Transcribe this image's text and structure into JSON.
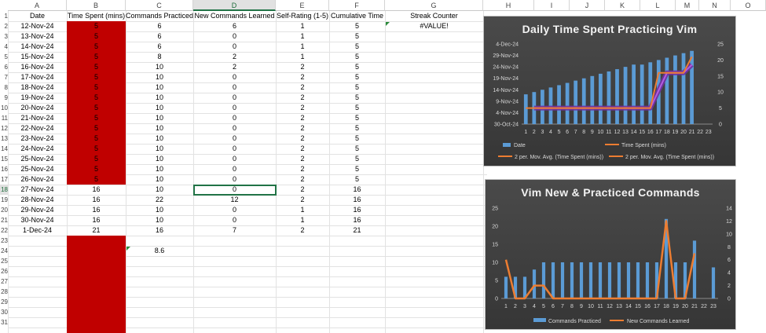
{
  "columns": [
    "A",
    "B",
    "C",
    "D",
    "E",
    "F",
    "G",
    "H",
    "I",
    "J",
    "K",
    "L",
    "M",
    "N",
    "O"
  ],
  "selected_column": "D",
  "selected_row": "18",
  "row_numbers": [
    "1",
    "2",
    "3",
    "4",
    "5",
    "6",
    "7",
    "8",
    "9",
    "10",
    "11",
    "12",
    "13",
    "14",
    "15",
    "16",
    "17",
    "18",
    "19",
    "20",
    "21",
    "22",
    "23",
    "24",
    "25",
    "26",
    "27",
    "28",
    "29",
    "30",
    "31"
  ],
  "headers": {
    "date": "Date",
    "time": "Time Spent (mins)",
    "practiced": "Commands Practiced",
    "learned": "New Commands Learned",
    "rating": "Self-Rating (1-5)",
    "cumulative": "Cumulative Time",
    "streak": "Streak Counter"
  },
  "streak_value": "#VALUE!",
  "rows": [
    {
      "date": "12-Nov-24",
      "time": "5",
      "practiced": "6",
      "learned": "6",
      "rating": "1",
      "cumulative": "5"
    },
    {
      "date": "13-Nov-24",
      "time": "5",
      "practiced": "6",
      "learned": "0",
      "rating": "1",
      "cumulative": "5"
    },
    {
      "date": "14-Nov-24",
      "time": "5",
      "practiced": "6",
      "learned": "0",
      "rating": "1",
      "cumulative": "5"
    },
    {
      "date": "15-Nov-24",
      "time": "5",
      "practiced": "8",
      "learned": "2",
      "rating": "1",
      "cumulative": "5"
    },
    {
      "date": "16-Nov-24",
      "time": "5",
      "practiced": "10",
      "learned": "2",
      "rating": "2",
      "cumulative": "5"
    },
    {
      "date": "17-Nov-24",
      "time": "5",
      "practiced": "10",
      "learned": "0",
      "rating": "2",
      "cumulative": "5"
    },
    {
      "date": "18-Nov-24",
      "time": "5",
      "practiced": "10",
      "learned": "0",
      "rating": "2",
      "cumulative": "5"
    },
    {
      "date": "19-Nov-24",
      "time": "5",
      "practiced": "10",
      "learned": "0",
      "rating": "2",
      "cumulative": "5"
    },
    {
      "date": "20-Nov-24",
      "time": "5",
      "practiced": "10",
      "learned": "0",
      "rating": "2",
      "cumulative": "5"
    },
    {
      "date": "21-Nov-24",
      "time": "5",
      "practiced": "10",
      "learned": "0",
      "rating": "2",
      "cumulative": "5"
    },
    {
      "date": "22-Nov-24",
      "time": "5",
      "practiced": "10",
      "learned": "0",
      "rating": "2",
      "cumulative": "5"
    },
    {
      "date": "23-Nov-24",
      "time": "5",
      "practiced": "10",
      "learned": "0",
      "rating": "2",
      "cumulative": "5"
    },
    {
      "date": "24-Nov-24",
      "time": "5",
      "practiced": "10",
      "learned": "0",
      "rating": "2",
      "cumulative": "5"
    },
    {
      "date": "25-Nov-24",
      "time": "5",
      "practiced": "10",
      "learned": "0",
      "rating": "2",
      "cumulative": "5"
    },
    {
      "date": "25-Nov-24",
      "time": "5",
      "practiced": "10",
      "learned": "0",
      "rating": "2",
      "cumulative": "5"
    },
    {
      "date": "26-Nov-24",
      "time": "5",
      "practiced": "10",
      "learned": "0",
      "rating": "2",
      "cumulative": "5"
    },
    {
      "date": "27-Nov-24",
      "time": "16",
      "practiced": "10",
      "learned": "0",
      "rating": "2",
      "cumulative": "16"
    },
    {
      "date": "28-Nov-24",
      "time": "16",
      "practiced": "22",
      "learned": "12",
      "rating": "2",
      "cumulative": "16"
    },
    {
      "date": "29-Nov-24",
      "time": "16",
      "practiced": "10",
      "learned": "0",
      "rating": "1",
      "cumulative": "16"
    },
    {
      "date": "30-Nov-24",
      "time": "16",
      "practiced": "10",
      "learned": "0",
      "rating": "1",
      "cumulative": "16"
    },
    {
      "date": "1-Dec-24",
      "time": "21",
      "practiced": "16",
      "learned": "7",
      "rating": "2",
      "cumulative": "21"
    }
  ],
  "average_value": "8.6",
  "colors": {
    "red_fill": "#c00000",
    "chart_bg": "#404040",
    "bar_blue": "#5b9bd5",
    "line_orange": "#ed7d31",
    "mavg_purple": "#7030a0",
    "selection_green": "#217346"
  },
  "chart_data": [
    {
      "type": "bar",
      "title": "Daily Time Spent Practicing Vim",
      "categories": [
        "1",
        "2",
        "3",
        "4",
        "5",
        "6",
        "7",
        "8",
        "9",
        "10",
        "11",
        "12",
        "13",
        "14",
        "15",
        "16",
        "17",
        "18",
        "19",
        "20",
        "21",
        "22",
        "23"
      ],
      "left_axis_ticks": [
        "30-Oct-24",
        "4-Nov-24",
        "9-Nov-24",
        "14-Nov-24",
        "19-Nov-24",
        "24-Nov-24",
        "29-Nov-24",
        "4-Dec-24"
      ],
      "right_axis_ticks": [
        "0",
        "5",
        "10",
        "15",
        "20",
        "25"
      ],
      "ylim_left": [
        "30-Oct-24",
        "4-Dec-24"
      ],
      "ylim_right": [
        0,
        25
      ],
      "series": [
        {
          "name": "Date",
          "kind": "bar",
          "axis": "left",
          "values": [
            "12-Nov-24",
            "13-Nov-24",
            "14-Nov-24",
            "15-Nov-24",
            "16-Nov-24",
            "17-Nov-24",
            "18-Nov-24",
            "19-Nov-24",
            "20-Nov-24",
            "21-Nov-24",
            "22-Nov-24",
            "23-Nov-24",
            "24-Nov-24",
            "25-Nov-24",
            "25-Nov-24",
            "26-Nov-24",
            "27-Nov-24",
            "28-Nov-24",
            "29-Nov-24",
            "30-Nov-24",
            "1-Dec-24"
          ]
        },
        {
          "name": "Time Spent (mins)",
          "kind": "line",
          "axis": "right",
          "values": [
            5,
            5,
            5,
            5,
            5,
            5,
            5,
            5,
            5,
            5,
            5,
            5,
            5,
            5,
            5,
            5,
            16,
            16,
            16,
            16,
            21
          ]
        },
        {
          "name": "2 per. Mov. Avg. (Time Spent (mins))",
          "kind": "trend",
          "axis": "right",
          "values": [
            null,
            5,
            5,
            5,
            5,
            5,
            5,
            5,
            5,
            5,
            5,
            5,
            5,
            5,
            5,
            5,
            10.5,
            16,
            16,
            16,
            18.5
          ]
        },
        {
          "name": "2 per. Mov. Avg. (Time Spent (mins))",
          "kind": "trend",
          "axis": "right",
          "values": [
            null,
            5,
            5,
            5,
            5,
            5,
            5,
            5,
            5,
            5,
            5,
            5,
            5,
            5,
            5,
            5,
            10.5,
            16,
            16,
            16,
            18.5
          ]
        }
      ],
      "legend": "bottom"
    },
    {
      "type": "bar",
      "title": "Vim New & Practiced Commands",
      "categories": [
        "1",
        "2",
        "3",
        "4",
        "5",
        "6",
        "7",
        "8",
        "9",
        "10",
        "11",
        "12",
        "13",
        "14",
        "15",
        "16",
        "17",
        "18",
        "19",
        "20",
        "21",
        "22",
        "23"
      ],
      "left_axis_ticks": [
        "0",
        "5",
        "10",
        "15",
        "20",
        "25"
      ],
      "right_axis_ticks": [
        "0",
        "2",
        "4",
        "6",
        "8",
        "10",
        "12",
        "14"
      ],
      "ylim_left": [
        0,
        25
      ],
      "ylim_right": [
        0,
        14
      ],
      "series": [
        {
          "name": "Commands Practiced",
          "kind": "bar",
          "axis": "left",
          "values": [
            6,
            6,
            6,
            8,
            10,
            10,
            10,
            10,
            10,
            10,
            10,
            10,
            10,
            10,
            10,
            10,
            10,
            22,
            10,
            10,
            16,
            0,
            8.6
          ]
        },
        {
          "name": "New Commands Learned",
          "kind": "line",
          "axis": "right",
          "values": [
            6,
            0,
            0,
            2,
            2,
            0,
            0,
            0,
            0,
            0,
            0,
            0,
            0,
            0,
            0,
            0,
            0,
            12,
            0,
            0,
            7
          ]
        }
      ],
      "legend": "bottom"
    }
  ]
}
